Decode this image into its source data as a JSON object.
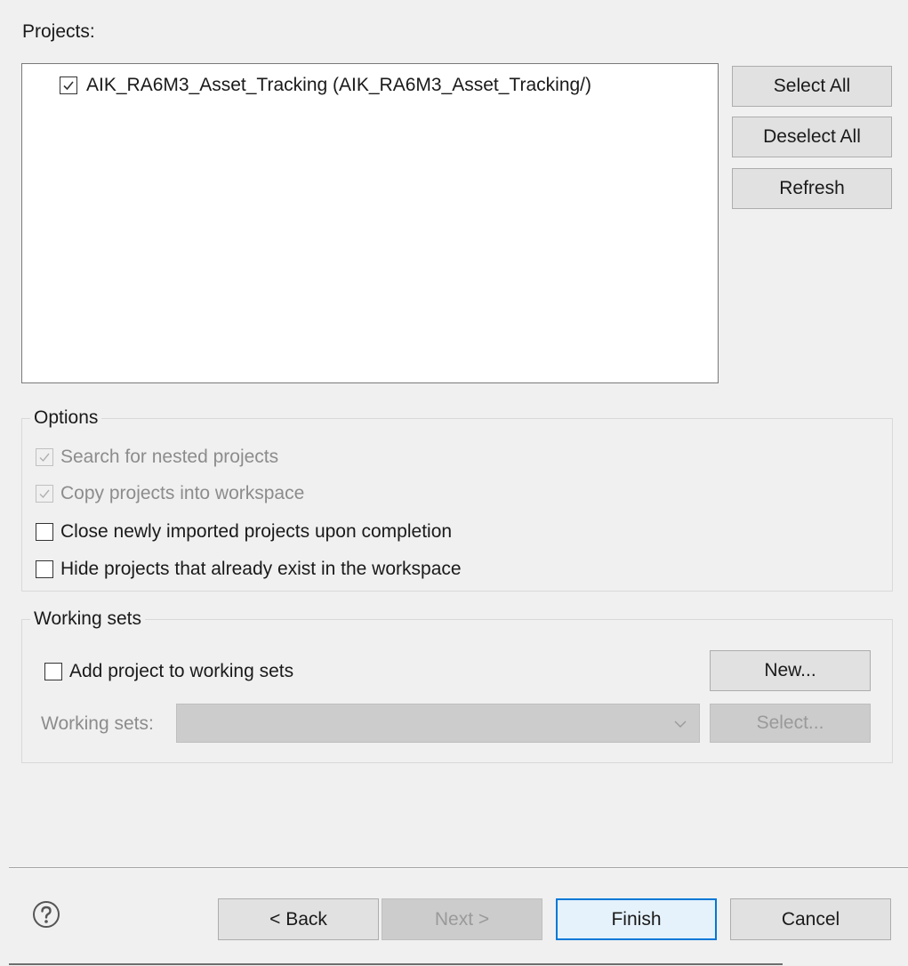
{
  "projects": {
    "label": "Projects:",
    "items": [
      {
        "label": "AIK_RA6M3_Asset_Tracking (AIK_RA6M3_Asset_Tracking/)",
        "checked": true
      }
    ],
    "buttons": {
      "select_all": "Select All",
      "deselect_all": "Deselect All",
      "refresh": "Refresh"
    }
  },
  "options": {
    "title": "Options",
    "search_nested": "Search for nested projects",
    "copy_into_workspace": "Copy projects into workspace",
    "close_imported": "Close newly imported projects upon completion",
    "hide_existing": "Hide projects that already exist in the workspace"
  },
  "working_sets": {
    "title": "Working sets",
    "add_label": "Add project to working sets",
    "new_button": "New...",
    "sets_label": "Working sets:",
    "select_button": "Select..."
  },
  "footer": {
    "back": "< Back",
    "next": "Next >",
    "finish": "Finish",
    "cancel": "Cancel"
  },
  "colors": {
    "accent": "#0078d7",
    "background": "#f0f0f0"
  }
}
